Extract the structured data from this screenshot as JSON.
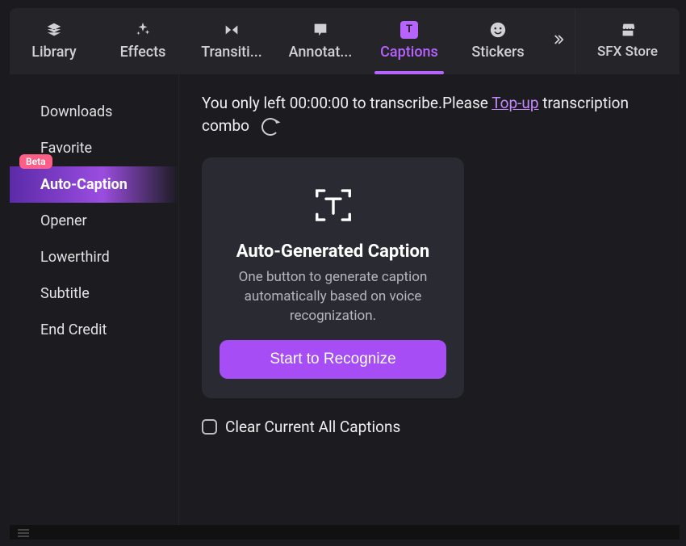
{
  "tabs": {
    "library": "Library",
    "effects": "Effects",
    "transitions": "Transiti...",
    "annotations": "Annotat...",
    "captions": "Captions",
    "stickers": "Stickers",
    "sfx_store": "SFX Store"
  },
  "sidebar": {
    "beta_label": "Beta",
    "items": [
      {
        "label": "Downloads"
      },
      {
        "label": "Favorite"
      },
      {
        "label": "Auto-Caption",
        "active": true,
        "beta": true
      },
      {
        "label": "Opener"
      },
      {
        "label": "Lowerthird"
      },
      {
        "label": "Subtitle"
      },
      {
        "label": "End Credit"
      }
    ]
  },
  "notice": {
    "prefix": "You only left ",
    "time": "00:00:00",
    "mid": " to transcribe.Please ",
    "link": "Top-up",
    "suffix": " transcription combo"
  },
  "card": {
    "title": "Auto-Generated Caption",
    "desc": "One button to generate caption automatically based on voice recognization.",
    "button": "Start to Recognize"
  },
  "clear": {
    "label": "Clear Current All Captions"
  },
  "colors": {
    "accent": "#b763ff",
    "button": "#a64df5",
    "beta": "#ff5f87"
  }
}
